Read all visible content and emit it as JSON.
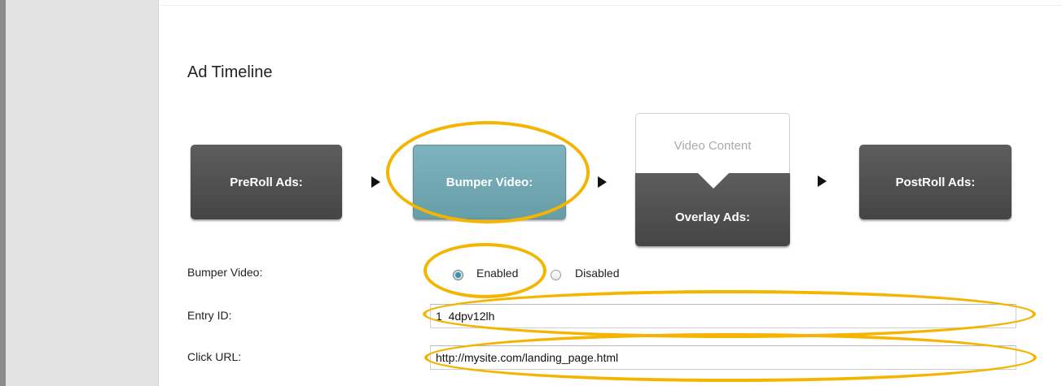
{
  "section": {
    "title": "Ad Timeline"
  },
  "timeline": {
    "preroll_label": "PreRoll Ads:",
    "bumper_label": "Bumper Video:",
    "video_content_label": "Video Content",
    "overlay_label": "Overlay Ads:",
    "postroll_label": "PostRoll Ads:",
    "arrow_icon": "play-triangle",
    "bumper_color": "#74a9b3"
  },
  "form": {
    "bumper_video_label": "Bumper Video:",
    "bumper_options": [
      {
        "label": "Enabled",
        "selected": true
      },
      {
        "label": "Disabled",
        "selected": false
      }
    ],
    "entry_id_label": "Entry ID:",
    "entry_id_value": "1_4dpv12lh",
    "click_url_label": "Click URL:",
    "click_url_value": "http://mysite.com/landing_page.html"
  },
  "annotations": {
    "highlight_color": "#f4b400"
  }
}
